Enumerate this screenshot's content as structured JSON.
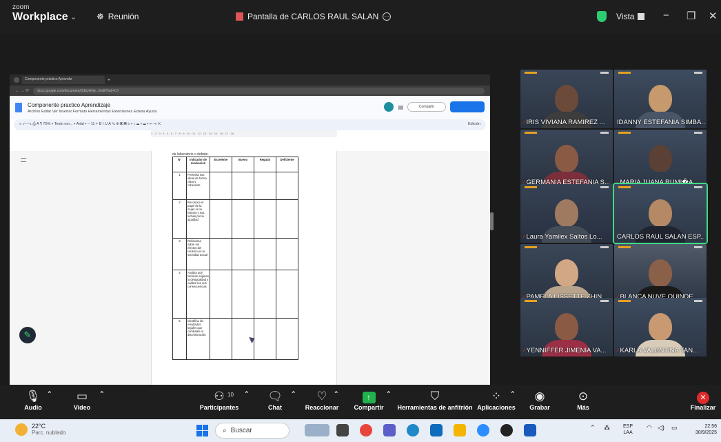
{
  "app": {
    "brand_small": "zoom",
    "brand_name": "Workplace",
    "meeting_label": "Reunión",
    "share_title": "Pantalla de CARLOS RAUL SALAN",
    "view_label": "Vista"
  },
  "shared_doc": {
    "browser_tab": "Componente práctico Aprendiz",
    "url": "docs.google.com/document/d/1kyfeNy...l/edit?tab=t.0",
    "title": "Componente practico Aprendizaje",
    "menu": "Archivo   Editar   Ver   Insertar   Formato   Herramientas   Extensiones   Extesa   Ayuda",
    "share_button": "Compartir",
    "toolbar": "⌕  ↶  ↷  ⎙  A  ¶   75%  ▾   Texto nor...  ▾    Arial   ▾   −  11  +   B  I  U  A  ✎   ⊕  ▣  ▤   ≡ ▾  ↕   ☰ ▾  ☰ ▾   ⇤  ⇥  ✕",
    "edit_mode": "Edición",
    "page_text": "de laboratorio o debate.",
    "table_headers": [
      "N°",
      "Indicador de evaluación",
      "Excelente",
      "Bueno",
      "Regular",
      "Deficiente"
    ],
    "table_rows": [
      {
        "n": "1",
        "indicator": "Presenta sus ideas de forma clara y coherente"
      },
      {
        "n": "2",
        "indicator": "Reconoce el papel de la mujer en la historia y sus luchas por la igualdad"
      },
      {
        "n": "3",
        "indicator": "Reflexiona sobre los efectos del racismo en la sociedad actual"
      },
      {
        "n": "4",
        "indicator": "Analiza qué factores originan la desigualdad y cuáles son sus consecuencias"
      },
      {
        "n": "5",
        "indicator": "Identifica los resultados legales que combaten la discriminación"
      }
    ]
  },
  "participants": [
    {
      "name": "IRIS VIVIANA RAMIREZ ...",
      "muted": true,
      "active": false
    },
    {
      "name": "IDANNY ESTEFANIA SIMBA...",
      "muted": false,
      "active": false
    },
    {
      "name": "GERMANIA ESTEFANIA S...",
      "muted": true,
      "active": false
    },
    {
      "name": "MARIA JUANA RUMI�A...",
      "muted": true,
      "active": false
    },
    {
      "name": "Laura  Yamilex Saltos Lo...",
      "muted": true,
      "active": false
    },
    {
      "name": "CARLOS RAUL SALAN ESP...",
      "muted": false,
      "active": true
    },
    {
      "name": "PAMELA LISSETTE ZHIN...",
      "muted": true,
      "active": false
    },
    {
      "name": "BLANCA NUVE QUINDE ...",
      "muted": true,
      "active": false
    },
    {
      "name": "YENNIFFER JIMENIA VA...",
      "muted": true,
      "active": false
    },
    {
      "name": "KARLA VALENTINA TAN...",
      "muted": true,
      "active": false
    }
  ],
  "controls": {
    "audio": "Audio",
    "video": "Video",
    "participants": "Participantes",
    "participants_count": "10",
    "chat": "Chat",
    "react": "Reaccionar",
    "share": "Compartir",
    "host_tools": "Herramientas de anfitrión",
    "apps": "Aplicaciones",
    "record": "Grabar",
    "more": "Más",
    "end": "Finalizar"
  },
  "taskbar": {
    "temperature": "22°C",
    "weather": "Parc. nublado",
    "search_placeholder": "Buscar",
    "lang_top": "ESP",
    "lang_bottom": "LAA",
    "time": "22:56",
    "date": "30/9/2025"
  }
}
